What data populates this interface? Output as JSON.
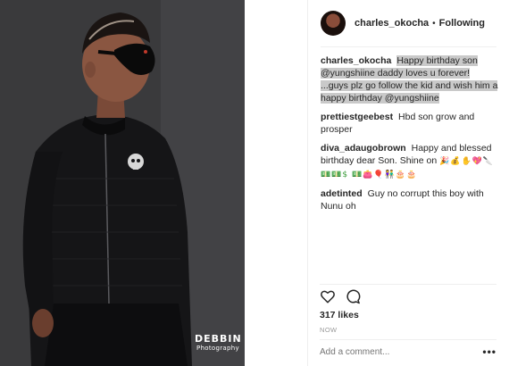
{
  "post": {
    "username": "charles_okocha",
    "separator": "•",
    "follow_status": "Following",
    "watermark_main": "DEBBIN",
    "watermark_sub": "Photography",
    "comments": [
      {
        "user": "charles_okocha",
        "text": "Happy birthday son @yungshiine daddy loves u forever! ...guys plz go follow the kid and wish him a happy birthday @yungshiine",
        "highlighted": true
      },
      {
        "user": "prettiestgeebest",
        "text": "Hbd son grow and prosper"
      },
      {
        "user": "diva_adaugobrown",
        "text": "Happy and blessed birthday dear Son. Shine on",
        "emojis": "🎉💰✋💖🔪💵💵$ 💵👛🎈👫🎂🎂"
      },
      {
        "user": "adetinted",
        "text": "Guy no corrupt this boy with Nunu oh"
      }
    ],
    "likes": "317 likes",
    "time": "NOW",
    "add_comment_placeholder": "Add a comment...",
    "more_label": "•••"
  },
  "icons": {
    "like": "heart-icon",
    "comment": "comment-bubble-icon",
    "more": "more-options-icon"
  }
}
